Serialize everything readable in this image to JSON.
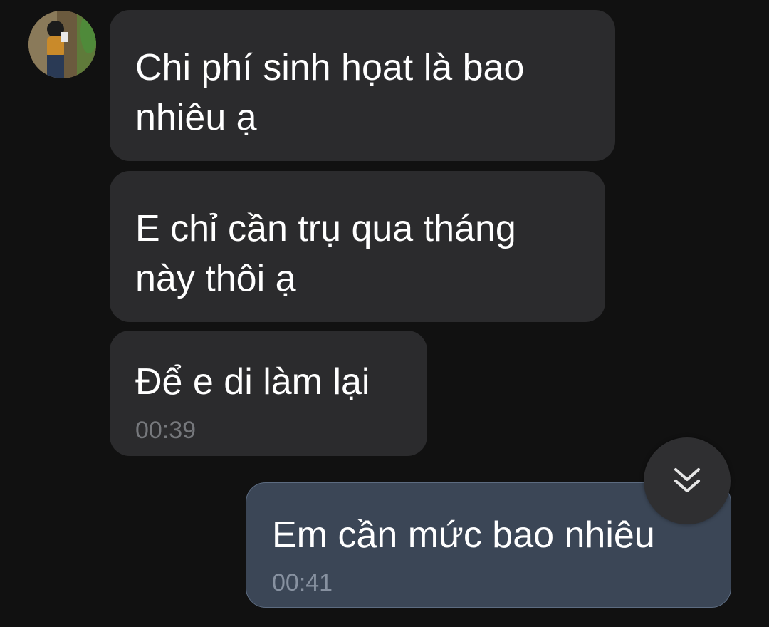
{
  "messages": [
    {
      "direction": "incoming",
      "text": "Chi phí sinh họat là bao nhiêu ạ",
      "time": ""
    },
    {
      "direction": "incoming",
      "text": "E chỉ cần trụ qua tháng này thôi ạ",
      "time": ""
    },
    {
      "direction": "incoming",
      "text": "Để e di làm lại",
      "time": "00:39"
    },
    {
      "direction": "outgoing",
      "text": "Em cần mức bao nhiêu",
      "time": "00:41"
    }
  ],
  "scroll_button": {
    "icon": "double-chevron-down-icon"
  },
  "colors": {
    "background": "#111111",
    "incoming_bubble": "#2b2b2d",
    "outgoing_bubble": "#3b4656",
    "timestamp": "#76787c"
  }
}
